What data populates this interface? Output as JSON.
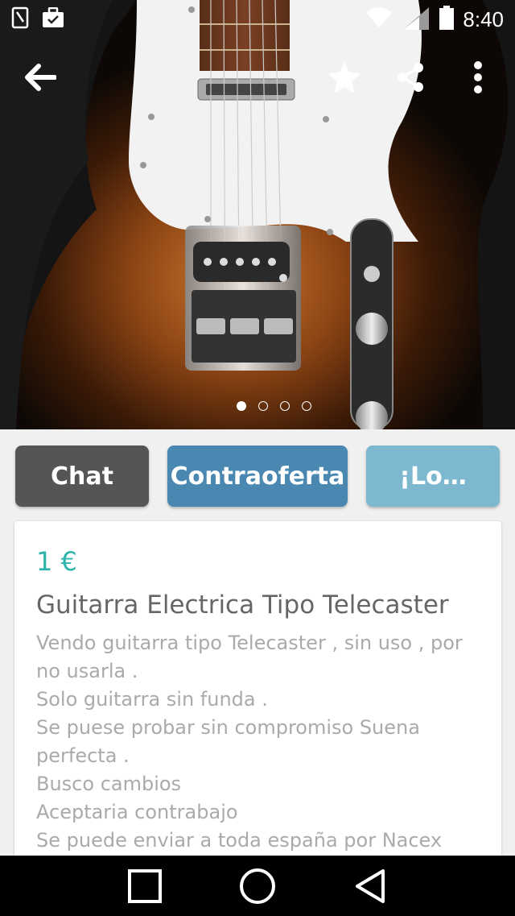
{
  "status_bar": {
    "time": "8:40",
    "icons": [
      "sim-card-icon",
      "briefcase-check-icon",
      "wifi-icon",
      "cell-signal-icon",
      "battery-icon"
    ]
  },
  "hero": {
    "image_description_icon": "guitar-photo",
    "carousel_count": 4,
    "carousel_active_index": 0
  },
  "toolbar": {
    "back_icon": "arrow-left-icon",
    "favorite_icon": "star-icon",
    "share_icon": "share-icon",
    "more_icon": "more-vert-icon"
  },
  "actions": {
    "chat_label": "Chat",
    "offer_label": "Contraoferta",
    "buy_label": "¡Lo…"
  },
  "colors": {
    "chat_button": "#555555",
    "offer_button": "#4a88b2",
    "buy_button": "#7eb8d0",
    "price": "#2bb5aa"
  },
  "listing": {
    "price": "1 €",
    "title": "Guitarra Electrica Tipo Telecaster",
    "description_lines": [
      "Vendo guitarra tipo Telecaster , sin uso , por",
      "no usarla .",
      "Solo guitarra sin funda .",
      "Se puese probar sin compromiso Suena",
      "perfecta .",
      "Busco cambios",
      "Aceptaria contrabajo",
      "Se puede enviar a toda españa por Nacex"
    ]
  },
  "nav_bar": {
    "recents_icon": "recents-square-icon",
    "home_icon": "home-circle-icon",
    "back_icon": "back-triangle-icon"
  }
}
